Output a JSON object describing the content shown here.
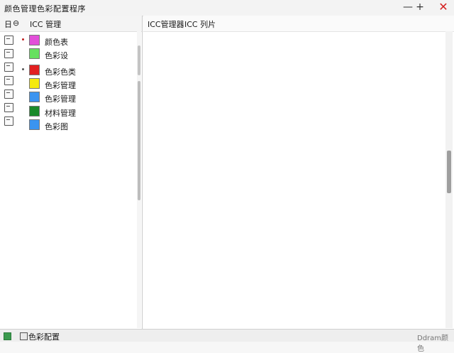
{
  "window": {
    "title": "颜色管理色彩配置程序",
    "minimize_glyph": "—",
    "maximize_glyph": "+",
    "close_glyph": "✕"
  },
  "left_panel": {
    "header_glyph_a": "日",
    "header_glyph_b": "⊖",
    "header_title": "ICC 管理"
  },
  "color_items": [
    {
      "label": "颜色表",
      "swatch": "#e24fd9",
      "bullet": "#c02020"
    },
    {
      "label": "色彩设",
      "swatch": "#67e060",
      "bullet": ""
    },
    {
      "label": "色彩色类",
      "swatch": "#e22020",
      "bullet": "#555555"
    },
    {
      "label": "色彩管理",
      "swatch": "#f5ea0e",
      "bullet": ""
    },
    {
      "label": "色彩管理",
      "swatch": "#3b94f0",
      "bullet": ""
    },
    {
      "label": "材料管理",
      "swatch": "#1a8a2a",
      "bullet": ""
    },
    {
      "label": "色彩图",
      "swatch": "#3b94f0",
      "bullet": ""
    }
  ],
  "side_icons": [
    "tool-icon",
    "image-icon",
    "document-icon",
    "page-icon",
    "save-icon",
    "folder-icon",
    "disk-icon"
  ],
  "right_panel": {
    "tab_a": "ICC管理器",
    "tab_b": "ICC 列片"
  },
  "statusbar": {
    "text": "色彩配置",
    "right_text": "Ddram颜色"
  }
}
